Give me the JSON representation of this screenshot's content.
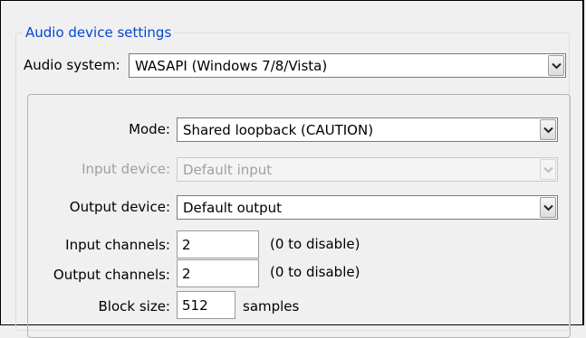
{
  "group": {
    "title": "Audio device settings"
  },
  "audio_system": {
    "label": "Audio system:",
    "value": "WASAPI (Windows 7/8/Vista)"
  },
  "mode": {
    "label": "Mode:",
    "value": "Shared loopback (CAUTION)"
  },
  "input_device": {
    "label": "Input device:",
    "value": "Default input"
  },
  "output_device": {
    "label": "Output device:",
    "value": "Default output"
  },
  "input_channels": {
    "label": "Input channels:",
    "value": "2",
    "hint": "(0 to disable)"
  },
  "output_channels": {
    "label": "Output channels:",
    "value": "2",
    "hint": "(0 to disable)"
  },
  "block_size": {
    "label": "Block size:",
    "value": "512",
    "unit": "samples"
  },
  "icons": {
    "dropdown": "chevron-down-icon"
  }
}
